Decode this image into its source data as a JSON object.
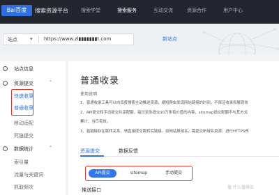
{
  "header": {
    "logo_text": "Bai百度",
    "brand": "搜索资源平台",
    "nav": [
      "搜索学堂",
      "搜索服务",
      "互动交流",
      "资源合作",
      "用户中心"
    ],
    "active_nav": "搜索服务"
  },
  "site_selector": {
    "label": "站点",
    "url": "https://www.zl▮▮▮▮▮▮▮t.com",
    "add_site": "新站点"
  },
  "sidebar": {
    "site_info": "站点信息",
    "resource_submit": "资源提交",
    "fast_include": "快速收录",
    "normal_include": "普通收录",
    "mobile_adapt": "移动适配",
    "dead_link": "死链提交",
    "data_stats": "数据统计",
    "index": "索引量",
    "traffic": "流量与关键词",
    "crawl": "抓取频次"
  },
  "main": {
    "title": "普通收录",
    "usage_heading": "使用说明",
    "instructions": [
      "1、普通收录工具可以向百度搜索主动推送资源，缩短爬虫发现网站链接的时间，不保证收录和展现效",
      "2、API提交和手动提交共享配额，每日至多提交10万条有价值的内容，sitemap提交配额不与其方式",
      "    累计，当日有效。",
      "3、若链接存在跳转关系，请直接提交跳转后链接。如网站换域名，需提交新域名资源，进行HTTPS改"
    ],
    "tabs": [
      "资源提交",
      "数据反馈"
    ],
    "methods": [
      "API提交",
      "sitemap",
      "手动提交"
    ],
    "sub_heading": "推送接口"
  },
  "watermark": "值 什么值得买",
  "colors": {
    "accent": "#2f6fe0",
    "highlight_box": "#e03a2f",
    "topbar_bg": "#23262e"
  }
}
